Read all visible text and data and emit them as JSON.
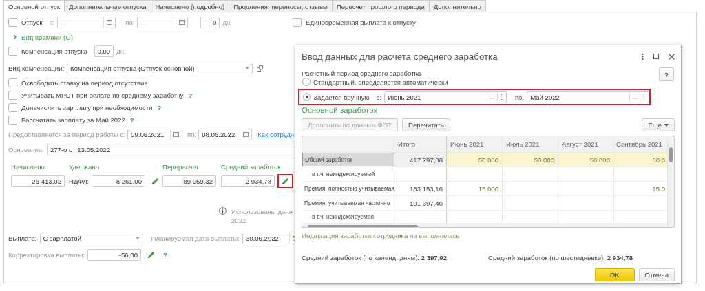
{
  "tabs": [
    {
      "label": "Основной отпуск",
      "selected": true
    },
    {
      "label": "Дополнительные отпуска",
      "selected": false
    },
    {
      "label": "Начислено (подробно)",
      "selected": false
    },
    {
      "label": "Продления, переносы, отзывы",
      "selected": false
    },
    {
      "label": "Пересчет прошлого периода",
      "selected": false
    },
    {
      "label": "Дополнительно",
      "selected": false
    }
  ],
  "leave": {
    "label": "Отпуск",
    "checked": false,
    "from_label": "с:",
    "from_placeholder": ". .",
    "to_label": "по:",
    "to_placeholder": ". .",
    "days": "0",
    "days_unit": "дн."
  },
  "lump_sum": {
    "label": "Единовременная выплата к отпуску",
    "checked": false
  },
  "time_kind": {
    "label": "Вид времени (О)",
    "expanded": false
  },
  "compensation": {
    "label": "Компенсация отпуска",
    "checked": false,
    "days": "0,00",
    "days_unit": "дн."
  },
  "compensation_kind": {
    "label": "Вид компенсации:",
    "value": "Компенсация отпуска (Отпуск основной)"
  },
  "options": [
    {
      "label": "Освободить ставку на период отсутствия",
      "checked": false
    },
    {
      "label": "Учитывать МРОТ при оплате по среднему заработку",
      "checked": false,
      "help": "?"
    },
    {
      "label": "Доначислить зарплату при необходимости",
      "checked": false,
      "help": "?"
    },
    {
      "label": "Рассчитать зарплату за Май 2022",
      "checked": false,
      "help": "?"
    }
  ],
  "work_period": {
    "label": "Предоставляется за период работы с:",
    "from": "09.06.2021",
    "to_label": "по:",
    "to": "08.06.2022",
    "link": "Как сотрудн"
  },
  "basis": {
    "label": "Основание:",
    "value": "277-о от 13.05.2022"
  },
  "totals": [
    {
      "label": "Начислено",
      "value": "26 413,02"
    },
    {
      "label": "Удержано",
      "prefix": "НДФЛ:",
      "value": "-8 261,00",
      "editable": true
    },
    {
      "label": "Перерасчет",
      "value": "-89 959,32"
    },
    {
      "label": "Средний заработок",
      "value": "2 934,78",
      "editable": true,
      "highlighted": true
    }
  ],
  "info": {
    "lines": [
      "Использованы данн",
      "2022"
    ]
  },
  "payment": {
    "label": "Выплата:",
    "value": "С зарплатой",
    "date_label": "Планируемая дата выплаты:",
    "date": "30.06.2022"
  },
  "adjustment": {
    "label": "Корректировка выплаты:",
    "value": "-56,00",
    "editable": true,
    "help": "?"
  },
  "dialog": {
    "title": "Ввод данных для расчета среднего заработка",
    "help": "?",
    "period_label": "Расчетный период среднего заработка",
    "modes": [
      {
        "label": "Стандартный, определяется автоматически",
        "selected": false
      },
      {
        "label": "Задается вручную",
        "selected": true
      }
    ],
    "period": {
      "highlighted": true,
      "from_label": "с:",
      "from": "Июнь 2021",
      "from_button": "...",
      "to_label": "по:",
      "to": "Май 2022",
      "to_button": "..."
    },
    "section": "Основной заработок",
    "buttons": [
      {
        "label": "Дополнить по данным ФОТ",
        "disabled": true
      },
      {
        "label": "Перечитать",
        "disabled": false
      }
    ],
    "more": "Еще",
    "table": {
      "columns": [
        "Итого",
        "Июнь 2021",
        "Июль 2021",
        "Август 2021",
        "Сентябрь 2021"
      ],
      "rows": [
        {
          "name": "Общий заработок",
          "total": "417 797,08",
          "col_1": "50 000",
          "col_2": "50 000",
          "col_3": "50 000",
          "col_4": "50 0",
          "selected": true,
          "children": [
            {
              "name": "в т.ч. неиндексируемый",
              "selected": false
            }
          ]
        },
        {
          "name": "Премия, полностью учитываемая",
          "total": "183 153,16",
          "col_1": "15 000",
          "col_4": "15 0",
          "selected": false
        },
        {
          "name": "Премия, учитываемая частично",
          "total": "101 397,40",
          "selected": false,
          "children": [
            {
              "name": "в т.ч. неиндексируемая",
              "selected": false
            }
          ]
        }
      ]
    },
    "indexing_note": "Индексация заработка сотрудника не выполнялась",
    "averages": [
      {
        "label": "Средний заработок (по календ. дням):",
        "value": "2 397,92"
      },
      {
        "label": "Средний заработок (по шестидневке):",
        "value": "2 934,78"
      }
    ],
    "ok": "OK",
    "cancel": "Отмена"
  }
}
